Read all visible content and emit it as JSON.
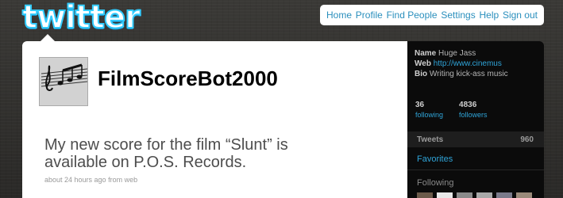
{
  "logo": {
    "text": "twitter"
  },
  "nav": {
    "items": [
      {
        "label": "Home"
      },
      {
        "label": "Profile"
      },
      {
        "label": "Find People"
      },
      {
        "label": "Settings"
      },
      {
        "label": "Help"
      },
      {
        "label": "Sign out"
      }
    ]
  },
  "profile": {
    "username": "FilmScoreBot2000",
    "avatar_icon": "sheet-music-icon"
  },
  "tweet": {
    "text": "My new score for the film “Slunt” is available on P.O.S. Records.",
    "time": "about 24 hours ago",
    "source": "from web"
  },
  "sidebar": {
    "name_label": "Name",
    "name_value": "Huge Jass",
    "web_label": "Web",
    "web_value": "http://www.cinemus",
    "bio_label": "Bio",
    "bio_value": "Writing kick-ass music",
    "following_count": "36",
    "following_label": "following",
    "followers_count": "4836",
    "followers_label": "followers",
    "tweets_label": "Tweets",
    "tweets_count": "960",
    "favorites_label": "Favorites",
    "following_heading": "Following"
  },
  "colors": {
    "accent": "#2fa4d8",
    "logo_stroke": "#33ccff",
    "sidebar_bg": "#0b0b0b"
  }
}
